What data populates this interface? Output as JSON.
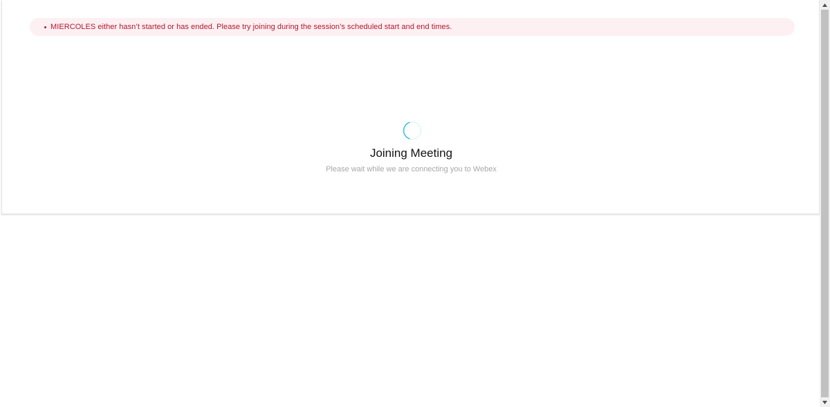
{
  "alert": {
    "message": "MIERCOLES either hasn’t started or has ended. Please try joining during the session’s scheduled start and end times.",
    "color": "#b3162f",
    "background": "#fdf0f2"
  },
  "loading": {
    "title": "Joining Meeting",
    "subtitle": "Please wait while we are connecting you to Webex",
    "spinner_icon": "loading-spinner-icon",
    "spinner_color": "#2bc5d6"
  },
  "scrollbar": {
    "up_icon": "scroll-up-arrow-icon",
    "down_icon": "scroll-down-arrow-icon"
  }
}
